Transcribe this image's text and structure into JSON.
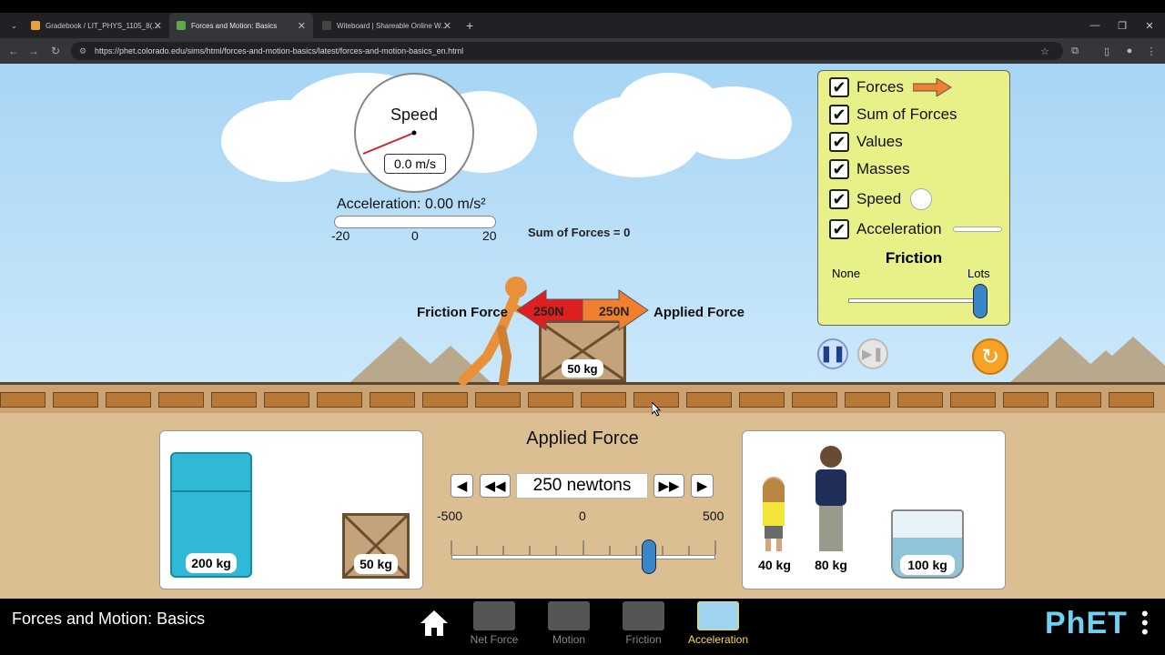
{
  "browser": {
    "tabs": [
      {
        "title": "Gradebook / LIT_PHYS_1105_8(...",
        "active": false
      },
      {
        "title": "Forces and Motion: Basics",
        "active": true
      },
      {
        "title": "Witeboard | Shareable Online W...",
        "active": false
      }
    ],
    "url": "https://phet.colorado.edu/sims/html/forces-and-motion-basics/latest/forces-and-motion-basics_en.html"
  },
  "sim": {
    "speedometer": {
      "title": "Speed",
      "readout": "0.0 m/s"
    },
    "acceleration": {
      "label": "Acceleration: 0.00 m/s²",
      "min": "-20",
      "mid": "0",
      "max": "20"
    },
    "sum_of_forces": "Sum of Forces = 0",
    "friction_force_label": "Friction Force",
    "applied_force_label": "Applied Force",
    "friction_arrow_value": "250N",
    "applied_arrow_value": "250N",
    "crate_mass": "50 kg",
    "control_panel": {
      "checkboxes": [
        "Forces",
        "Sum of Forces",
        "Values",
        "Masses",
        "Speed",
        "Acceleration"
      ],
      "friction_title": "Friction",
      "friction_none": "None",
      "friction_lots": "Lots",
      "friction_level": 1.0
    },
    "applied_force": {
      "title": "Applied Force",
      "value": "250 newtons",
      "min": "-500",
      "mid": "0",
      "max": "500",
      "current": 250
    },
    "left_tray": {
      "fridge_mass": "200 kg",
      "crate_mass": "50 kg"
    },
    "right_tray": {
      "girl_mass": "40 kg",
      "man_mass": "80 kg",
      "bucket_mass": "100 kg"
    }
  },
  "navbar": {
    "title": "Forces and Motion: Basics",
    "screens": [
      "Net Force",
      "Motion",
      "Friction",
      "Acceleration"
    ],
    "active_screen": "Acceleration",
    "logo": "PhET"
  },
  "colors": {
    "panel": "#e8f088",
    "sky": "#a7d5f5",
    "accent_active": "#ffd93b",
    "arrow_applied": "#f08030",
    "arrow_friction": "#e02020"
  }
}
